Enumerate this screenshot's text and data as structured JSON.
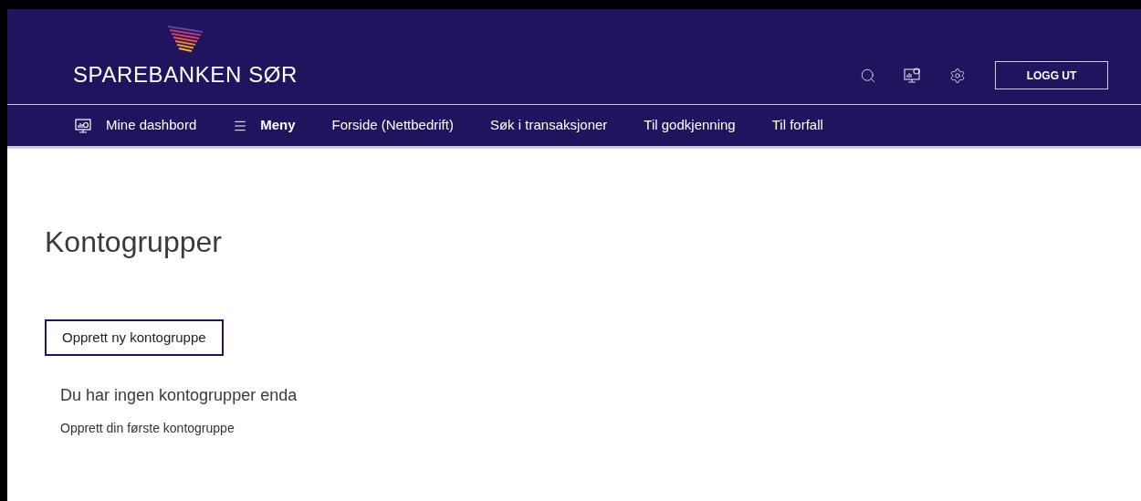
{
  "header": {
    "logo": "SPAREBANKEN SØR",
    "logout_button": "LOGG UT"
  },
  "nav": [
    {
      "label": "Mine dashbord",
      "kind": "dashboard",
      "selected": false
    },
    {
      "label": "Meny",
      "kind": "menu",
      "selected": true
    },
    {
      "label": "Forside (Nettbedrift)",
      "kind": "link",
      "selected": false
    },
    {
      "label": "Søk i transaksjoner",
      "kind": "link",
      "selected": false
    },
    {
      "label": "Til godkjenning",
      "kind": "link",
      "selected": false
    },
    {
      "label": "Til forfall",
      "kind": "link",
      "selected": false
    }
  ],
  "page": {
    "title": "Kontogrupper",
    "create_button": "Opprett ny kontogruppe",
    "empty_title": "Du har ingen kontogrupper enda",
    "empty_text": "Opprett din første kontogruppe"
  }
}
